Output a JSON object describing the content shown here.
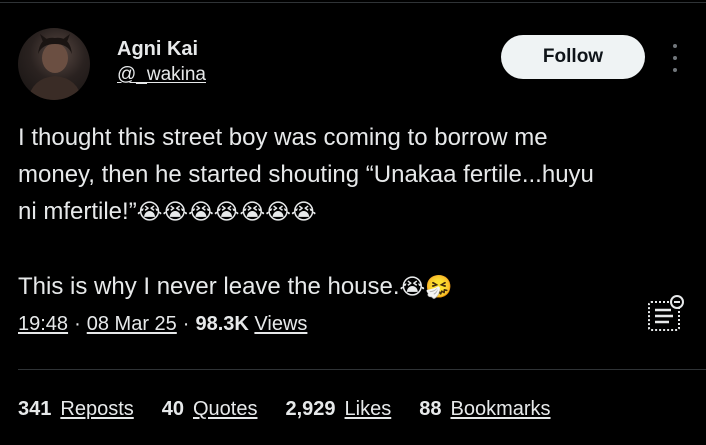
{
  "author": {
    "name": "Agni Kai",
    "handle": "@_wakina"
  },
  "actions": {
    "follow_label": "Follow",
    "more_icon": "more-vertical-icon"
  },
  "tweet": {
    "line1": "I thought this street boy was coming to borrow me",
    "line2": "money, then he started shouting “Unakaa fertile...huyu",
    "line3": "ni mfertile!”",
    "line3_emojis": "😭😭😭😭😭😭😭",
    "line4": "This is why I never leave the house.",
    "line4_emojis": "😭🤧"
  },
  "meta": {
    "time": "19:48",
    "date": "08 Mar 25",
    "views_count": "98.3K",
    "views_label": "Views",
    "separator": "·"
  },
  "stats": [
    {
      "count": "341",
      "label": "Reposts"
    },
    {
      "count": "40",
      "label": "Quotes"
    },
    {
      "count": "2,929",
      "label": "Likes"
    },
    {
      "count": "88",
      "label": "Bookmarks"
    }
  ],
  "colors": {
    "background": "#000000",
    "text": "#e7e9ea",
    "muted": "#71767b",
    "button_bg": "#eff3f4",
    "button_text": "#0f1419",
    "divider": "#2f3336"
  }
}
